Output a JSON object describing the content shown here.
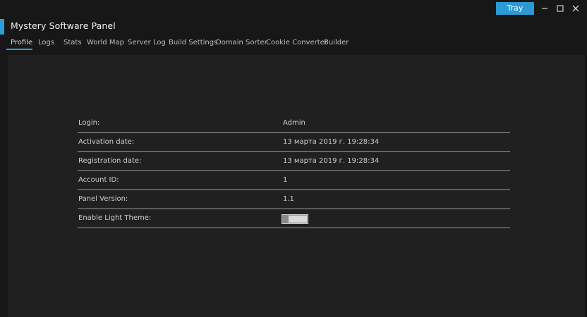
{
  "app": {
    "title": "Mystery Software Panel",
    "accent_color": "#2b9fd9"
  },
  "titlebar": {
    "tray_label": "Tray",
    "controls": [
      "minimize-icon",
      "maximize-icon",
      "close-icon"
    ]
  },
  "tabs": [
    {
      "label": "Profile",
      "active": true
    },
    {
      "label": "Logs"
    },
    {
      "label": "Stats"
    },
    {
      "label": "World Map"
    },
    {
      "label": "Server Log"
    },
    {
      "label": "Build Settings"
    },
    {
      "label": "Domain Sorter"
    },
    {
      "label": "Cookie Converter"
    },
    {
      "label": "Builder"
    }
  ],
  "profile": {
    "rows": [
      {
        "label": "Login:",
        "value": "Admin"
      },
      {
        "label": "Activation date:",
        "value": "13 марта 2019 г. 19:28:34"
      },
      {
        "label": "Registration date:",
        "value": "13 марта 2019 г. 19:28:34"
      },
      {
        "label": "Account ID:",
        "value": "1"
      },
      {
        "label": "Panel Version:",
        "value": "1.1"
      },
      {
        "label": "Enable Light Theme:",
        "value": null
      }
    ],
    "light_theme_enabled": true
  }
}
